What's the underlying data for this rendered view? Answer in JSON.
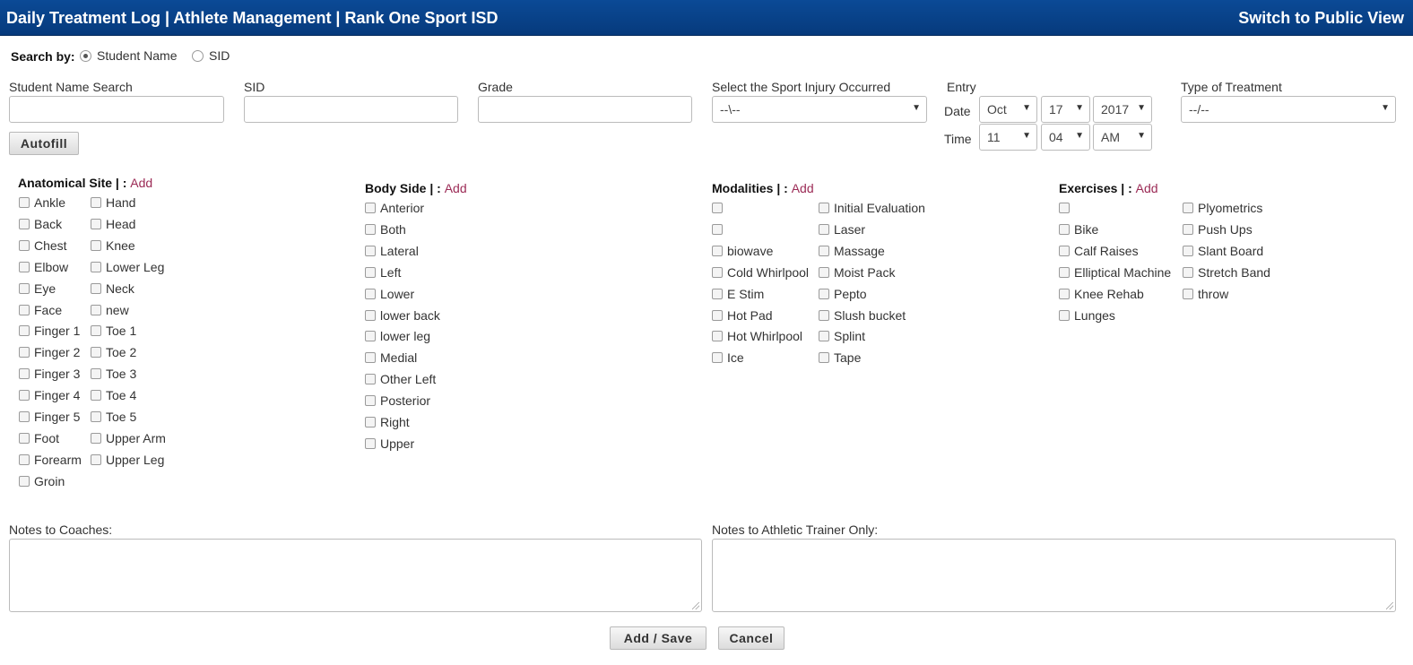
{
  "header": {
    "title": "Daily Treatment Log | Athlete Management | Rank One Sport ISD",
    "switch_label": "Switch to Public View"
  },
  "search": {
    "label": "Search by:",
    "options": [
      "Student Name",
      "SID"
    ],
    "selected": "Student Name"
  },
  "fields": {
    "student_name_label": "Student Name Search",
    "sid_label": "SID",
    "grade_label": "Grade",
    "sport_label": "Select the Sport Injury Occurred",
    "sport_value": "--\\--",
    "entry_label": "Entry",
    "date_label": "Date",
    "date_month": "Oct",
    "date_day": "17",
    "date_year": "2017",
    "time_label": "Time",
    "time_hour": "11",
    "time_minute": "04",
    "time_ampm": "AM",
    "treatment_label": "Type of Treatment",
    "treatment_value": "--/--"
  },
  "buttons": {
    "autofill": "Autofill",
    "save": "Add / Save",
    "cancel": "Cancel"
  },
  "groups": {
    "add_label": "Add",
    "separator": "| :",
    "anatomical": {
      "title": "Anatomical Site",
      "col1": [
        "Ankle",
        "Back",
        "Chest",
        "Elbow",
        "Eye",
        "Face",
        "Finger 1",
        "Finger 2",
        "Finger 3",
        "Finger 4",
        "Finger 5",
        "Foot",
        "Forearm",
        "Groin"
      ],
      "col2": [
        "Hand",
        "Head",
        "Knee",
        "Lower Leg",
        "Neck",
        "new",
        "Toe 1",
        "Toe 2",
        "Toe 3",
        "Toe 4",
        "Toe 5",
        "Upper Arm",
        "Upper Leg"
      ]
    },
    "body_side": {
      "title": "Body Side",
      "col1": [
        "Anterior",
        "Both",
        "Lateral",
        "Left",
        "Lower",
        "lower back",
        "lower leg",
        "Medial",
        "Other Left",
        "Posterior",
        "Right",
        "Upper"
      ]
    },
    "modalities": {
      "title": "Modalities",
      "col1": [
        "",
        "",
        "biowave",
        "Cold Whirlpool",
        "E Stim",
        "Hot Pad",
        "Hot Whirlpool",
        "Ice"
      ],
      "col2": [
        "Initial Evaluation",
        "Laser",
        "Massage",
        "Moist Pack",
        "Pepto",
        "Slush bucket",
        "Splint",
        "Tape"
      ]
    },
    "exercises": {
      "title": "Exercises",
      "col1": [
        "",
        "Bike",
        "Calf Raises",
        "Elliptical Machine",
        "Knee Rehab",
        "Lunges"
      ],
      "col2": [
        "Plyometrics",
        "Push Ups",
        "Slant Board",
        "Stretch Band",
        "throw"
      ]
    }
  },
  "notes": {
    "coaches_label": "Notes to Coaches:",
    "trainer_label": "Notes to Athletic Trainer Only:"
  },
  "colors": {
    "header_bg": "#063a7c",
    "link": "#9b2a55"
  }
}
